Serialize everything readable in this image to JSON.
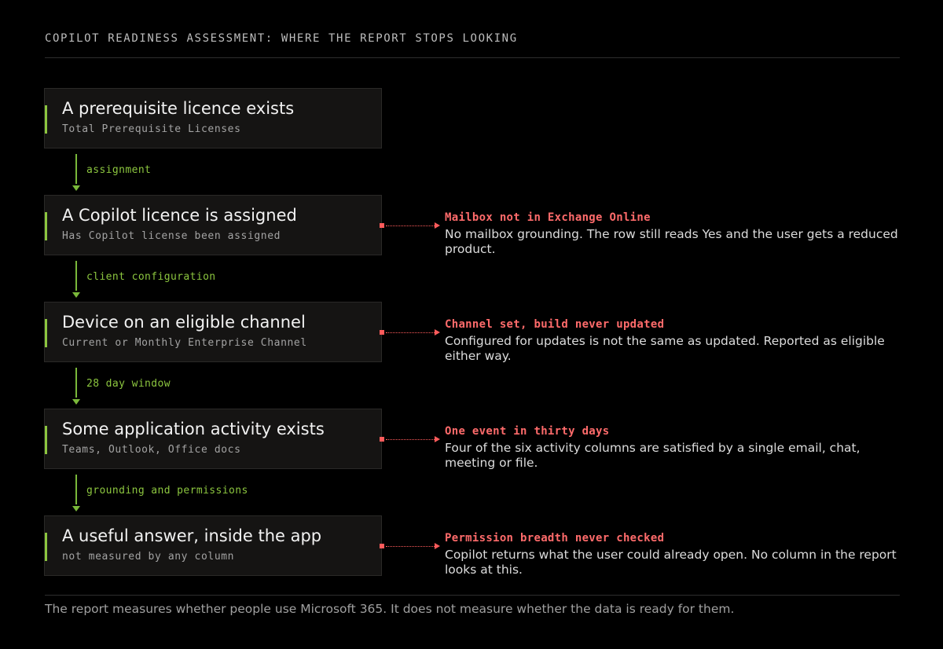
{
  "header": "COPILOT READINESS ASSESSMENT: WHERE THE REPORT STOPS LOOKING",
  "stages": [
    {
      "title": "A prerequisite licence exists",
      "subtitle": "Total Prerequisite Licenses"
    },
    {
      "title": "A Copilot licence is assigned",
      "subtitle": "Has Copilot license been assigned"
    },
    {
      "title": "Device on an eligible channel",
      "subtitle": "Current or Monthly Enterprise Channel"
    },
    {
      "title": "Some application activity exists",
      "subtitle": "Teams, Outlook, Office docs"
    },
    {
      "title": "A useful answer, inside the app",
      "subtitle": "not measured by any column"
    }
  ],
  "connectors": [
    "assignment",
    "client configuration",
    "28 day window",
    "grounding and permissions"
  ],
  "notes": [
    {
      "title": "Mailbox not in Exchange Online",
      "body": "No mailbox grounding. The row still reads Yes and the user gets a reduced product."
    },
    {
      "title": "Channel set, build never updated",
      "body": "Configured for updates is not the same as updated. Reported as eligible either way."
    },
    {
      "title": "One event in thirty days",
      "body": "Four of the six activity columns are satisfied by a single email, chat, meeting or file."
    },
    {
      "title": "Permission breadth never checked",
      "body": "Copilot returns what the user could already open. No column in the report looks at this."
    }
  ],
  "footer": "The report measures whether people use Microsoft 365. It does not measure whether the data is ready for them.",
  "colors": {
    "accent_green": "#8cc63f",
    "accent_red": "#ff6b6b",
    "background": "#000000",
    "stage_fill": "#151413"
  }
}
